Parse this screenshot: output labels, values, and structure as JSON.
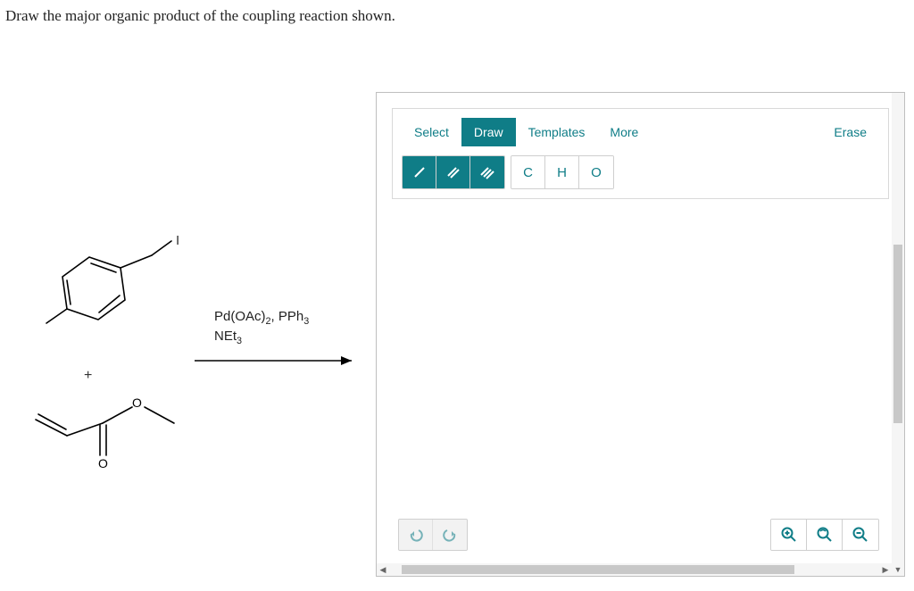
{
  "question": "Draw the major organic product of the coupling reaction shown.",
  "reagents": {
    "line1_html": "Pd(OAc)<sub>2</sub>, PPh<sub>3</sub>",
    "line2_html": "NEt<sub>3</sub>"
  },
  "plus": "+",
  "iodine_label": "I",
  "tabs": {
    "select": "Select",
    "draw": "Draw",
    "templates": "Templates",
    "more": "More",
    "erase": "Erase"
  },
  "bond_tools": {
    "single": "/",
    "double": "//",
    "triple": "///"
  },
  "element_tools": {
    "c": "C",
    "h": "H",
    "o": "O"
  },
  "history": {
    "undo": "↶",
    "redo": "↷"
  },
  "zoom": {
    "in": "⊕",
    "fit": "⟲",
    "out": "⊖"
  },
  "colors": {
    "teal": "#0f7d87",
    "panel_border": "#bfbfbf"
  }
}
